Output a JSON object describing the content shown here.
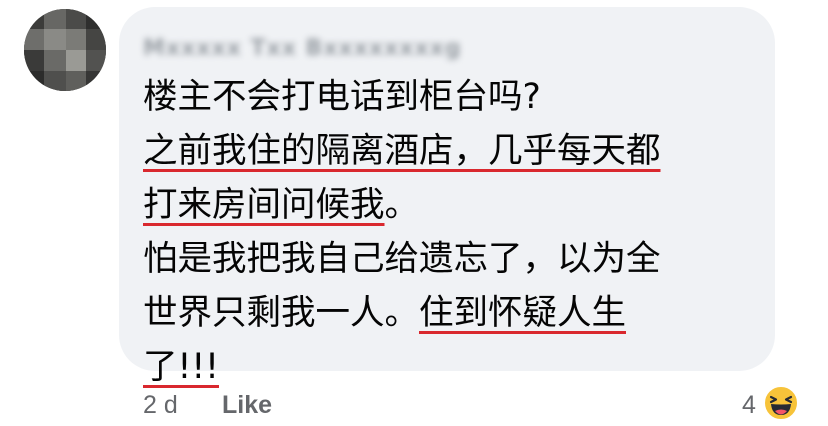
{
  "comment": {
    "author_name": "Mxxxxx Txx Bxxxxxxxxg",
    "lines": [
      {
        "segments": [
          {
            "text": "楼主不会打电话到柜台吗?",
            "underline": false
          }
        ]
      },
      {
        "segments": [
          {
            "text": "之前我住的隔离酒店，几乎每天都",
            "underline": true
          }
        ]
      },
      {
        "segments": [
          {
            "text": "打来房间问候我",
            "underline": true
          },
          {
            "text": "。",
            "underline": false
          }
        ]
      },
      {
        "segments": [
          {
            "text": "怕是我把我自己给遗忘了，以为全",
            "underline": false
          }
        ]
      },
      {
        "segments": [
          {
            "text": "世界只剩我一人。",
            "underline": false
          },
          {
            "text": "住到怀疑人生",
            "underline": true
          }
        ]
      },
      {
        "segments": [
          {
            "text": "了!!!",
            "underline": true
          }
        ]
      }
    ]
  },
  "footer": {
    "time": "2 d",
    "like_label": "Like",
    "reaction_count": "4",
    "reaction_icon": "haha-emoji-icon"
  },
  "colors": {
    "bubble_bg": "#f0f2f5",
    "underline": "#d9282e",
    "meta_text": "#65676b",
    "emoji_face": "#f7c33a"
  }
}
